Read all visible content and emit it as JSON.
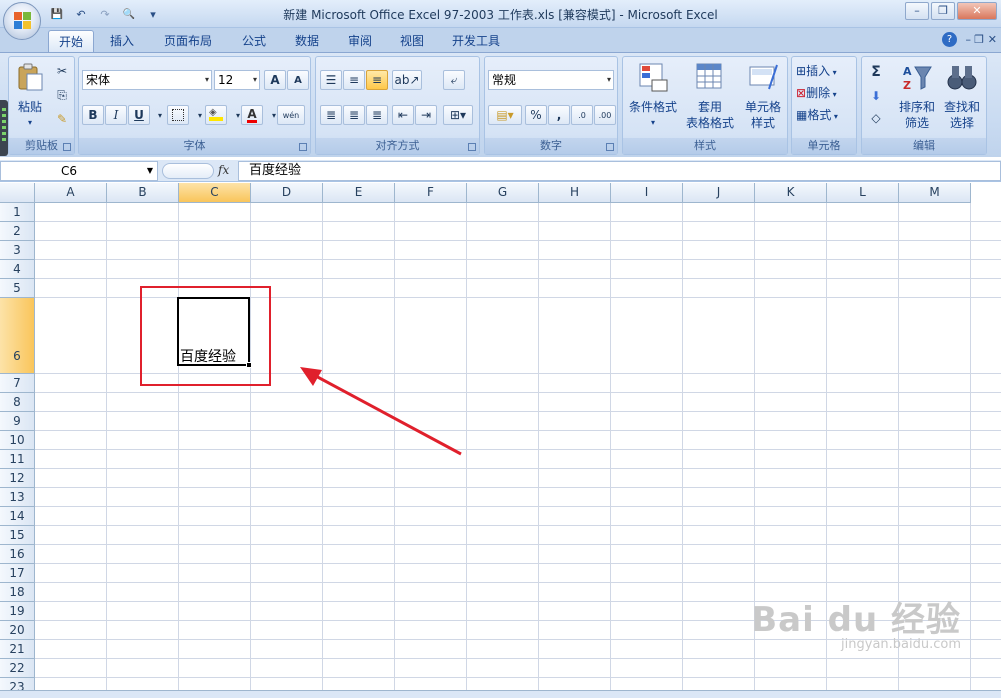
{
  "window": {
    "title": "新建 Microsoft Office Excel 97-2003 工作表.xls  [兼容模式] - Microsoft Excel",
    "minimize": "–",
    "restore": "❐",
    "close": "✕"
  },
  "qat": {
    "save": "💾",
    "undo": "↶",
    "redo": "↷",
    "preview": "🔍",
    "customize": "▾"
  },
  "tabs": [
    {
      "label": "开始",
      "active": true
    },
    {
      "label": "插入"
    },
    {
      "label": "页面布局"
    },
    {
      "label": "公式"
    },
    {
      "label": "数据"
    },
    {
      "label": "审阅"
    },
    {
      "label": "视图"
    },
    {
      "label": "开发工具"
    }
  ],
  "ribbon_controls": {
    "help": "?",
    "min": "–",
    "restore": "❐",
    "close": "✕"
  },
  "ribbon": {
    "clipboard": {
      "label": "剪贴板",
      "paste": "粘贴"
    },
    "font": {
      "label": "字体",
      "font_name": "宋体",
      "font_size": "12",
      "grow": "A",
      "shrink": "A",
      "bold": "B",
      "italic": "I",
      "underline": "U",
      "phonetic": "wén"
    },
    "alignment": {
      "label": "对齐方式"
    },
    "number": {
      "label": "数字",
      "format": "常规",
      "percent": "%",
      "comma": ",",
      "inc": ".0",
      "dec": ".00"
    },
    "styles": {
      "label": "样式",
      "cond": "条件格式",
      "table_1": "套用",
      "table_2": "表格格式",
      "cell_1": "单元格",
      "cell_2": "样式"
    },
    "cells": {
      "label": "单元格",
      "insert": "插入",
      "delete": "删除",
      "format": "格式"
    },
    "editing": {
      "label": "编辑",
      "sum": "Σ",
      "sort_1": "排序和",
      "sort_2": "筛选",
      "find_1": "查找和",
      "find_2": "选择"
    }
  },
  "formula_bar": {
    "name_box": "C6",
    "fx": "fx",
    "content": "百度经验"
  },
  "columns": [
    "A",
    "B",
    "C",
    "D",
    "E",
    "F",
    "G",
    "H",
    "I",
    "J",
    "K",
    "L",
    "M"
  ],
  "rows": [
    "1",
    "2",
    "3",
    "4",
    "5",
    "6",
    "7",
    "8",
    "9",
    "10",
    "11",
    "12",
    "13",
    "14",
    "15",
    "16",
    "17",
    "18",
    "19",
    "20",
    "21",
    "22",
    "23"
  ],
  "cells": {
    "C6": "百度经验"
  },
  "watermark": {
    "main": "Bai du 经验",
    "sub": "jingyan.baidu.com"
  },
  "colors": {
    "accent": "#15428b",
    "highlight": "#f9c55b",
    "annotation": "#e0202c"
  }
}
